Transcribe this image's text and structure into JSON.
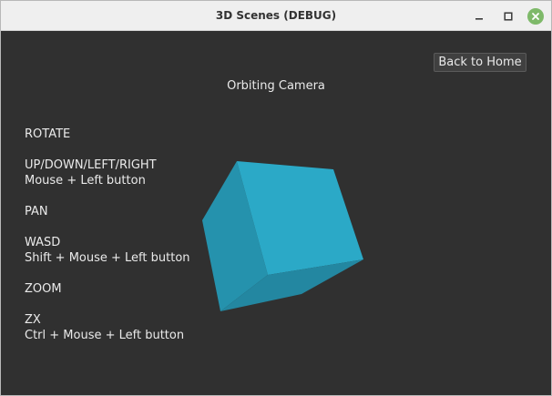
{
  "window": {
    "title": "3D Scenes (DEBUG)",
    "controls": {
      "minimize_icon": "minimize-icon",
      "maximize_icon": "maximize-icon",
      "close_icon": "close-icon"
    }
  },
  "scene": {
    "title": "Orbiting Camera",
    "back_button_label": "Back to Home",
    "background_color": "#303030",
    "cube_color": "#29a8c6"
  },
  "instructions": {
    "rotate_heading": "ROTATE",
    "rotate_keys": "UP/DOWN/LEFT/RIGHT",
    "rotate_mouse": "Mouse + Left button",
    "pan_heading": "PAN",
    "pan_keys": "WASD",
    "pan_mouse": "Shift + Mouse + Left button",
    "zoom_heading": "ZOOM",
    "zoom_keys": "ZX",
    "zoom_mouse": "Ctrl + Mouse + Left button"
  }
}
